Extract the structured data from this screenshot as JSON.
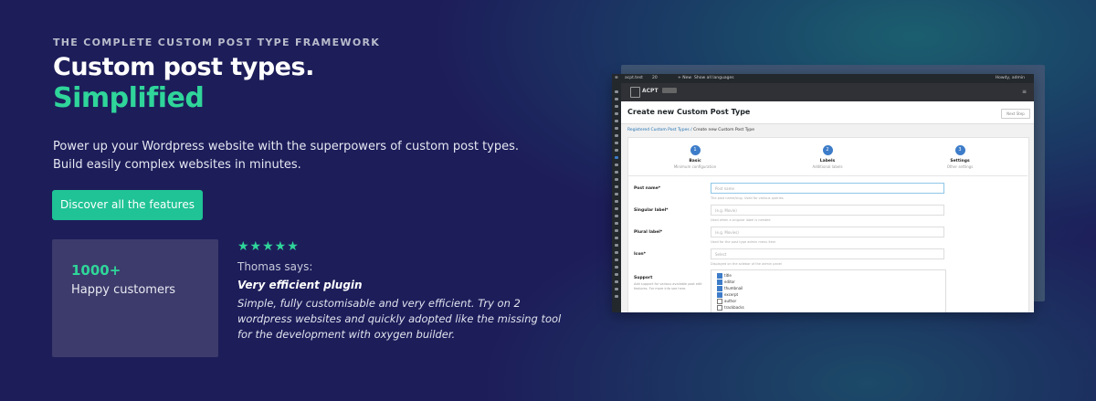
{
  "hero": {
    "eyebrow": "THE COMPLETE CUSTOM POST TYPE FRAMEWORK",
    "title_line1": "Custom post types.",
    "title_line2": "Simplified",
    "description_line1": "Power up your Wordpress website with the superpowers of custom post types.",
    "description_line2": "Build easily complex websites in minutes.",
    "cta_label": "Discover all the features"
  },
  "stat": {
    "value": "1000+",
    "label": "Happy customers"
  },
  "review": {
    "stars": "★★★★★",
    "rating": 5,
    "author_line": "Thomas says:",
    "title": "Very efficient plugin",
    "text": "Simple, fully customisable and very efficient. Try on 2 wordpress websites and quickly adopted like the missing tool for the development with oxygen builder."
  },
  "screenshot": {
    "adminbar_site": "acpt.test",
    "adminbar_count": "20",
    "adminbar_new": "+ New",
    "adminbar_lang": "Show all languages",
    "adminbar_user": "Howdy, admin",
    "brand": "ACPT",
    "page_title": "Create new Custom Post Type",
    "next_button": "Next Step",
    "breadcrumb_link": "Registered Custom Post Types",
    "breadcrumb_sep": "/",
    "breadcrumb_current": "Create new Custom Post Type",
    "steps": [
      {
        "num": "1",
        "title": "Basic",
        "subtitle": "Minimum configuration"
      },
      {
        "num": "2",
        "title": "Labels",
        "subtitle": "Additional labels"
      },
      {
        "num": "3",
        "title": "Settings",
        "subtitle": "Other settings"
      }
    ],
    "fields": {
      "post_name_label": "Post name*",
      "post_name_placeholder": "Post name",
      "post_name_help": "The post name/slug. Used for various queries.",
      "singular_label": "Singular label*",
      "singular_placeholder": "(e.g. Movie)",
      "singular_help": "Used when a singular label is needed",
      "plural_label": "Plural label*",
      "plural_placeholder": "(e.g. Movies)",
      "plural_help": "Used for the post type admin menu item",
      "icon_label": "Icon*",
      "icon_placeholder": "Select",
      "icon_help": "Displayed on the sidebar of the admin panel",
      "support_label": "Support",
      "support_desc": "Add support for various available post edit features. For more info see here.",
      "support_options": [
        {
          "label": "title",
          "checked": true
        },
        {
          "label": "editor",
          "checked": true
        },
        {
          "label": "thumbnail",
          "checked": true
        },
        {
          "label": "excerpt",
          "checked": true
        },
        {
          "label": "author",
          "checked": false
        },
        {
          "label": "trackbacks",
          "checked": false
        }
      ]
    }
  },
  "colors": {
    "accent": "#1fc395",
    "highlight": "#2fd59a",
    "background": "#1d1d5a",
    "stat_card": "#3d3b6b"
  }
}
